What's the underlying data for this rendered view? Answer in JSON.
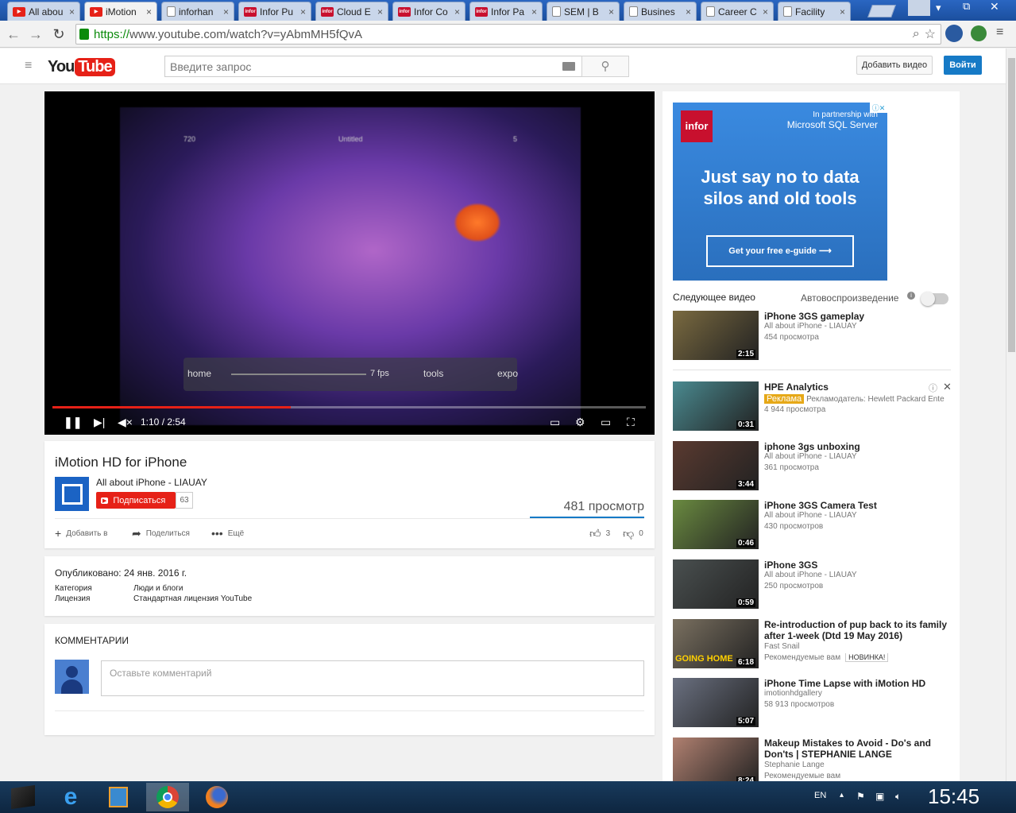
{
  "tabs": [
    {
      "label": "All abou",
      "icon": "yt"
    },
    {
      "label": "iMotion",
      "icon": "yt",
      "active": true
    },
    {
      "label": "inforhan",
      "icon": "doc"
    },
    {
      "label": "Infor Pu",
      "icon": "infor"
    },
    {
      "label": "Cloud E",
      "icon": "infor"
    },
    {
      "label": "Infor Co",
      "icon": "infor"
    },
    {
      "label": "Infor Pa",
      "icon": "infor"
    },
    {
      "label": "SEM | B",
      "icon": "doc"
    },
    {
      "label": "Busines",
      "icon": "doc"
    },
    {
      "label": "Career C",
      "icon": "doc"
    },
    {
      "label": "Facility",
      "icon": "doc"
    }
  ],
  "address": {
    "scheme": "https://",
    "rest": "www.youtube.com/watch?v=yAbmMH5fQvA"
  },
  "header": {
    "logo_you": "You",
    "logo_tube": "Tube",
    "search_placeholder": "Введите запрос",
    "upload": "Добавить видео",
    "signin": "Войти"
  },
  "player": {
    "time": "1:10 / 2:54",
    "progress": 0.402,
    "overlay": {
      "home": "home",
      "fps": "7 fps",
      "tools": "tools",
      "export": "expo",
      "untitled": "Untitled",
      "left_num": "720",
      "right_num": "5"
    }
  },
  "video": {
    "title": "iMotion HD for iPhone",
    "channel": "All about iPhone - LIAUAY",
    "subscribe": "Подписаться",
    "subs": "63",
    "views": "481 просмотр",
    "add": "Добавить в",
    "share": "Поделиться",
    "more": "Ещё",
    "likes": "3",
    "dislikes": "0"
  },
  "description": {
    "published": "Опубликовано: 24 янв. 2016 г.",
    "category_label": "Категория",
    "category": "Люди и блоги",
    "license_label": "Лицензия",
    "license": "Стандартная лицензия YouTube"
  },
  "comments": {
    "header": "КОММЕНТАРИИ",
    "placeholder": "Оставьте комментарий"
  },
  "ad": {
    "logo": "infor",
    "partner1": "In partnership with",
    "partner2": "Microsoft SQL Server",
    "headline": "Just say no to data silos and old tools",
    "cta": "Get your free e-guide"
  },
  "sidebar": {
    "next": "Следующее видео",
    "autoplay": "Автовоспроизведение",
    "videos": [
      {
        "title": "iPhone 3GS gameplay",
        "channel": "All about iPhone - LIAUAY",
        "meta": "454 просмотра",
        "dur": "2:15",
        "thumb": "#7a6a40"
      },
      {
        "title": "HPE Analytics",
        "channel": "Рекламодатель: Hewlett Packard Ente",
        "meta": "4 944 просмотра",
        "dur": "0:31",
        "badge": "Реклама",
        "thumb": "#4a8a90"
      },
      {
        "title": "iphone 3gs unboxing",
        "channel": "All about iPhone - LIAUAY",
        "meta": "361 просмотра",
        "dur": "3:44",
        "thumb": "#5a3a30"
      },
      {
        "title": "iPhone 3GS Camera Test",
        "channel": "All about iPhone - LIAUAY",
        "meta": "430 просмотров",
        "dur": "0:46",
        "thumb": "#6a8a40"
      },
      {
        "title": "iPhone 3GS",
        "channel": "All about iPhone - LIAUAY",
        "meta": "250 просмотров",
        "dur": "0:59",
        "thumb": "#4a5050"
      },
      {
        "title": "Re-introduction of pup back to its family after 1-week (Dtd 19 May 2016)",
        "channel": "Fast Snail",
        "meta": "Рекомендуемые вам",
        "dur": "6:18",
        "badge2": "НОВИНКА!",
        "thumb": "#7a7060",
        "overlay": "GOING HOME"
      },
      {
        "title": "iPhone Time Lapse with iMotion HD",
        "channel": "imotionhdgallery",
        "meta": "58 913 просмотров",
        "dur": "5:07",
        "thumb": "#6a7080"
      },
      {
        "title": "Makeup Mistakes to Avoid - Do's and Don'ts | STEPHANIE LANGE",
        "channel": "Stephanie Lange",
        "meta": "Рекомендуемые вам",
        "dur": "8:24",
        "thumb": "#b08070"
      }
    ]
  },
  "taskbar": {
    "lang": "EN",
    "clock": "15:45"
  }
}
